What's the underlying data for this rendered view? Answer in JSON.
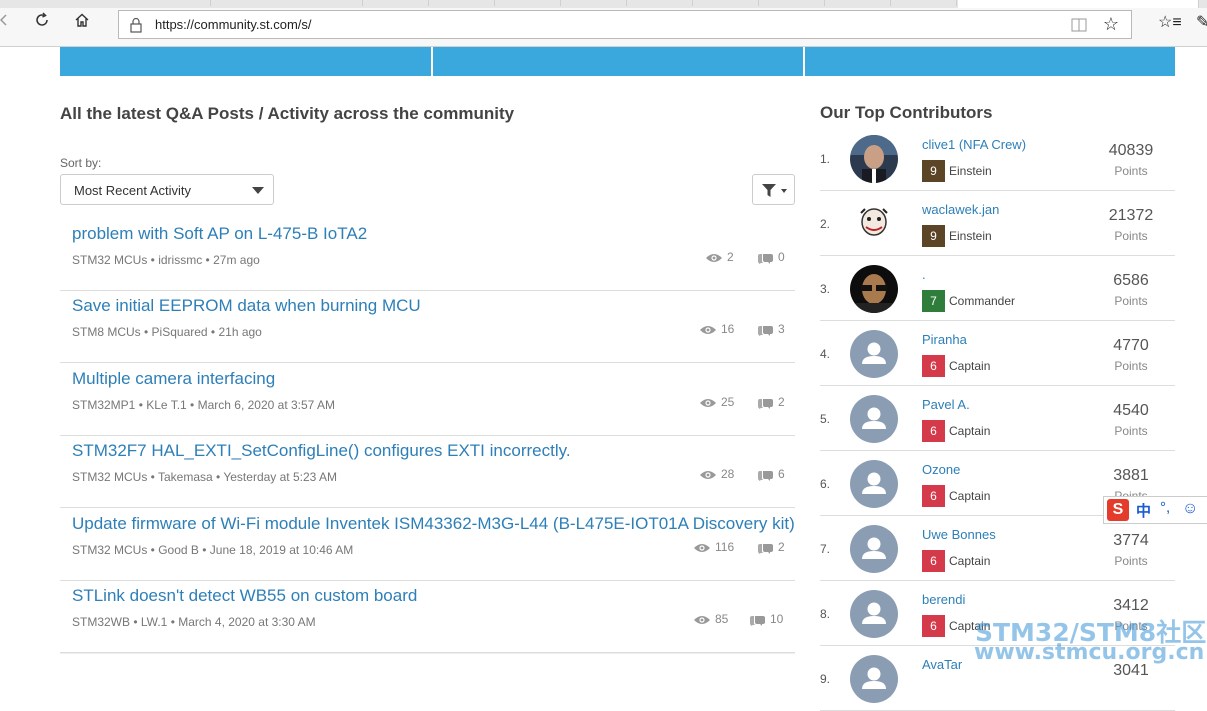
{
  "browser": {
    "url": "https://community.st.com/s/",
    "back_icon": "arrow-back-icon",
    "refresh_icon": "refresh-icon",
    "home_icon": "home-icon",
    "lock_icon": "lock-icon",
    "reader_icon": "reading-view-icon",
    "favorite_icon": "star-icon",
    "favorites_bar_icon": "favorites-icon"
  },
  "main": {
    "heading": "All the latest Q&A Posts / Activity across the community",
    "sort_label": "Sort by:",
    "sort_value": "Most Recent Activity",
    "posts": [
      {
        "title": "problem with Soft AP on L-475-B IoTA2",
        "category": "STM32 MCUs",
        "author": "idrissmc",
        "time": "27m ago",
        "views": "2",
        "replies": "0"
      },
      {
        "title": "Save initial EEPROM data when burning MCU",
        "category": "STM8 MCUs",
        "author": "PiSquared",
        "time": "21h ago",
        "views": "16",
        "replies": "3"
      },
      {
        "title": "Multiple camera interfacing",
        "category": "STM32MP1",
        "author": "KLe T.1",
        "time": "March 6, 2020 at 3:57 AM",
        "views": "25",
        "replies": "2"
      },
      {
        "title": "STM32F7 HAL_EXTI_SetConfigLine() configures EXTI incorrectly.",
        "category": "STM32 MCUs",
        "author": "Takemasa",
        "time": "Yesterday at 5:23 AM",
        "views": "28",
        "replies": "6"
      },
      {
        "title": "Update firmware of Wi-Fi module Inventek ISM43362-M3G-L44 (B-L475E-IOT01A Discovery kit)",
        "category": "STM32 MCUs",
        "author": "Good B",
        "time": "June 18, 2019 at 10:46 AM",
        "views": "116",
        "replies": "2"
      },
      {
        "title": "STLink doesn't detect WB55 on custom board",
        "category": "STM32WB",
        "author": "LW.1",
        "time": "March 4, 2020 at 3:30 AM",
        "views": "85",
        "replies": "10"
      }
    ]
  },
  "sidebar": {
    "title": "Our Top Contributors",
    "points_label": "Points",
    "contributors": [
      {
        "rank": "1.",
        "name": "clive1 (NFA Crew)",
        "level": "9",
        "level_name": "Einstein",
        "level_color": "#5c4527",
        "points": "40839",
        "avatar": "photo"
      },
      {
        "rank": "2.",
        "name": "waclawek.jan",
        "level": "9",
        "level_name": "Einstein",
        "level_color": "#5c4527",
        "points": "21372",
        "avatar": "face-drawing"
      },
      {
        "rank": "3.",
        "name": ".",
        "level": "7",
        "level_name": "Commander",
        "level_color": "#2f7d3a",
        "points": "6586",
        "avatar": "photo-dark"
      },
      {
        "rank": "4.",
        "name": "Piranha",
        "level": "6",
        "level_name": "Captain",
        "level_color": "#d43a4a",
        "points": "4770",
        "avatar": "default"
      },
      {
        "rank": "5.",
        "name": "Pavel A.",
        "level": "6",
        "level_name": "Captain",
        "level_color": "#d43a4a",
        "points": "4540",
        "avatar": "default"
      },
      {
        "rank": "6.",
        "name": "Ozone",
        "level": "6",
        "level_name": "Captain",
        "level_color": "#d43a4a",
        "points": "3881",
        "avatar": "default"
      },
      {
        "rank": "7.",
        "name": "Uwe Bonnes",
        "level": "6",
        "level_name": "Captain",
        "level_color": "#d43a4a",
        "points": "3774",
        "avatar": "default"
      },
      {
        "rank": "8.",
        "name": "berendi",
        "level": "6",
        "level_name": "Captain",
        "level_color": "#d43a4a",
        "points": "3412",
        "avatar": "default"
      },
      {
        "rank": "9.",
        "name": "AvaTar",
        "level": "",
        "level_name": "",
        "level_color": "#d43a4a",
        "points": "3041",
        "avatar": "default"
      }
    ]
  },
  "ime_toolbar": {
    "s_label": "S",
    "lang": "中",
    "punct": "°,",
    "emoji": "☺"
  },
  "watermark": {
    "line1": "STM32/STM8社区",
    "line2": "www.stmcu.org.cn"
  }
}
